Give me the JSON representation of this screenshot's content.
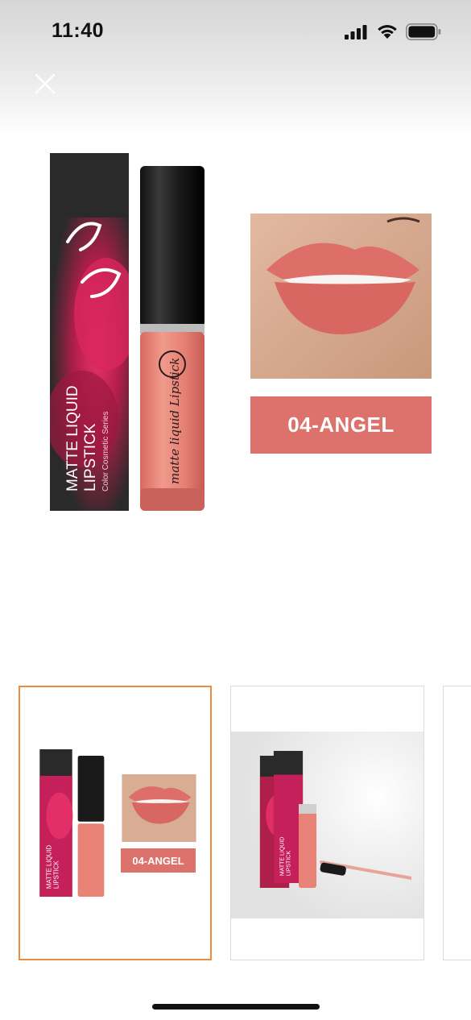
{
  "status_bar": {
    "time": "11:40"
  },
  "product": {
    "box_title_line1": "MATTE LIQUID",
    "box_title_line2": "LIPSTICK",
    "box_subtitle": "Color Cosmetic Series",
    "tube_label": "matte liquid Lipstick",
    "shade_label": "04-ANGEL"
  },
  "thumbnails": [
    {
      "shade_label": "04-ANGEL",
      "box_title_line1": "MATTE LIQUID",
      "box_title_line2": "LIPSTICK"
    },
    {
      "box_title_line1": "MATTE LIQUID",
      "box_title_line2": "LIPSTICK"
    }
  ],
  "colors": {
    "shade": "#dd726c",
    "selected_border": "#f08a3c",
    "box_dark": "#2a2a2a",
    "tube_pink": "#e98277"
  }
}
